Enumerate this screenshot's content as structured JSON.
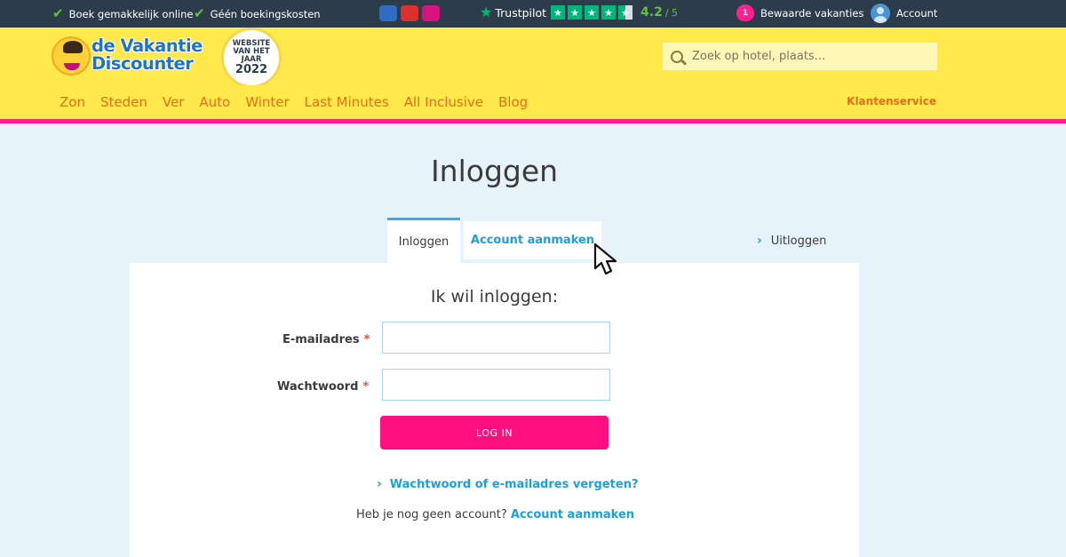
{
  "topbar": {
    "usps": [
      "Boek gemakkelijk online",
      "Géén boekingskosten"
    ],
    "trustpilot": {
      "name": "Trustpilot",
      "score": "4.2",
      "out_of": "/ 5",
      "stars_filled": 4,
      "star_half": true
    },
    "saved": {
      "label": "Bewaarde vakanties",
      "count": "1"
    },
    "account": {
      "label": "Account"
    }
  },
  "header": {
    "logo": {
      "line1": "de Vakantie",
      "line2": "Discounter"
    },
    "award": {
      "line1": "WEBSITE",
      "line2": "VAN HET",
      "line3": "JAAR",
      "year": "2022"
    },
    "search": {
      "placeholder": "Zoek op hotel, plaats..."
    }
  },
  "nav": {
    "items": [
      "Zon",
      "Steden",
      "Ver",
      "Auto",
      "Winter",
      "Last Minutes",
      "All Inclusive",
      "Blog"
    ],
    "service": "Klantenservice"
  },
  "main": {
    "title": "Inloggen",
    "tabs": {
      "login": "Inloggen",
      "create": "Account aanmaken"
    },
    "logout": "Uitloggen",
    "form": {
      "heading": "Ik wil inloggen:",
      "email_label": "E-mailadres",
      "password_label": "Wachtwoord",
      "required_mark": "*",
      "email_value": "",
      "password_value": "",
      "submit": "LOG IN",
      "forgot": "Wachtwoord of e-mailadres vergeten?",
      "no_account_text": "Heb je nog geen account?",
      "no_account_link": "Account aanmaken"
    }
  },
  "colors": {
    "topbar_bg": "#2c3c4b",
    "header_yellow": "#ffe94b",
    "nav_orange": "#e56f19",
    "accent_pink": "#ff0f7f",
    "link_blue": "#1d9fd9",
    "page_bg": "#e6f3fb",
    "check_green": "#5ec23c",
    "trustpilot_green": "#00b67a"
  }
}
